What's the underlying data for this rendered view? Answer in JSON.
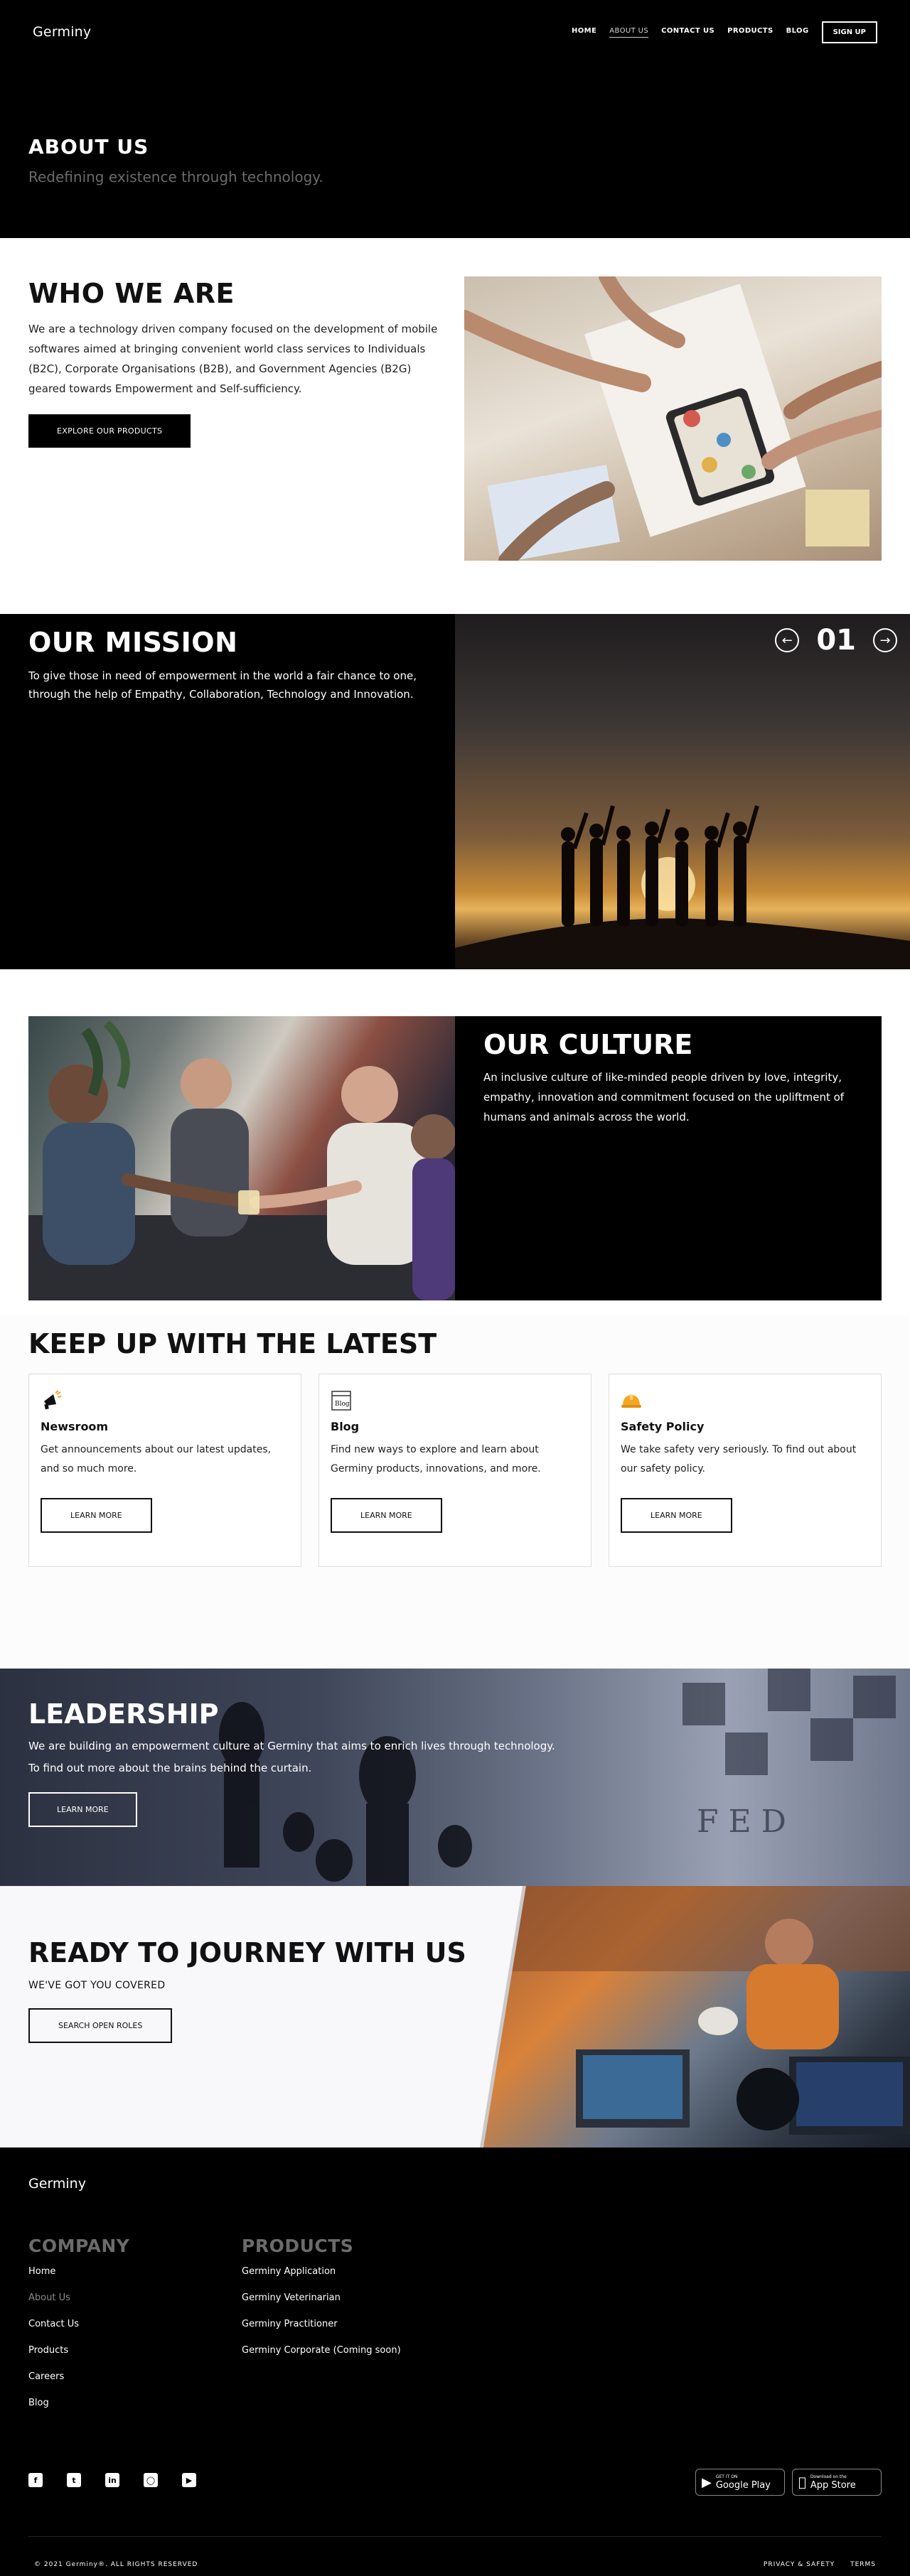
{
  "nav": {
    "logo": "Germiny",
    "links": [
      "HOME",
      "ABOUT US",
      "CONTACT US",
      "PRODUCTS",
      "BLOG"
    ],
    "signup": "SIGN UP"
  },
  "hero": {
    "title": "ABOUT US",
    "subtitle": "Redefining existence through technology."
  },
  "who": {
    "title": "WHO WE ARE",
    "body": "We are a technology driven company focused on the development of mobile softwares aimed at bringing convenient world class services to Individuals (B2C), Corporate Organisations (B2B), and Government Agencies (B2G) geared towards Empowerment and Self-sufficiency.",
    "button": "EXPLORE OUR PRODUCTS"
  },
  "mission": {
    "title": "OUR MISSION",
    "body": "To give those in need of empowerment in the world a fair chance to one, through the help of Empathy, Collaboration, Technology and Innovation.",
    "slide": "01"
  },
  "culture": {
    "title": "OUR CULTURE",
    "body": "An inclusive culture of like-minded people driven by love, integrity, empathy, innovation and commitment focused on the upliftment of humans and animals across the world."
  },
  "latest": {
    "title": "KEEP UP WITH THE LATEST",
    "cards": [
      {
        "title": "Newsroom",
        "body": "Get announcements about our latest updates, and so much more.",
        "button": "LEARN MORE",
        "icon": "megaphone-icon"
      },
      {
        "title": "Blog",
        "body": "Find new ways to explore and learn about Germiny products, innovations, and more.",
        "button": "LEARN MORE",
        "icon": "blog-icon",
        "icon_text": "Blog"
      },
      {
        "title": "Safety Policy",
        "body": "We take safety very seriously. To find out about our safety policy.",
        "button": "LEARN MORE",
        "icon": "hardhat-icon"
      }
    ]
  },
  "leadership": {
    "title": "LEADERSHIP",
    "line1": "We are building an empowerment culture at Germiny that aims to enrich lives through technology.",
    "line2": "To find out more about the brains behind the curtain.",
    "button": "LEARN MORE",
    "board_text": "F E D"
  },
  "journey": {
    "title": "READY TO JOURNEY WITH US",
    "subtitle": "WE'VE GOT YOU COVERED",
    "button": "SEARCH OPEN ROLES"
  },
  "footer": {
    "logo": "Germiny",
    "company_title": "COMPANY",
    "company_links": [
      "Home",
      "About Us",
      "Contact Us",
      "Products",
      "Careers",
      "Blog"
    ],
    "products_title": "PRODUCTS",
    "product_links": [
      "Germiny Application",
      "Germiny Veterinarian",
      "Germiny Practitioner",
      "Germiny Corporate (Coming soon)"
    ],
    "socials": [
      "facebook-icon",
      "twitter-icon",
      "linkedin-icon",
      "instagram-icon",
      "youtube-icon"
    ],
    "google_small": "GET IT ON",
    "google_big": "Google Play",
    "apple_small": "Download on the",
    "apple_big": "App Store",
    "copyright": "© 2021 Germiny®. ALL RIGHTS RESERVED",
    "privacy": "PRIVACY & SAFETY",
    "terms": "TERMS"
  }
}
